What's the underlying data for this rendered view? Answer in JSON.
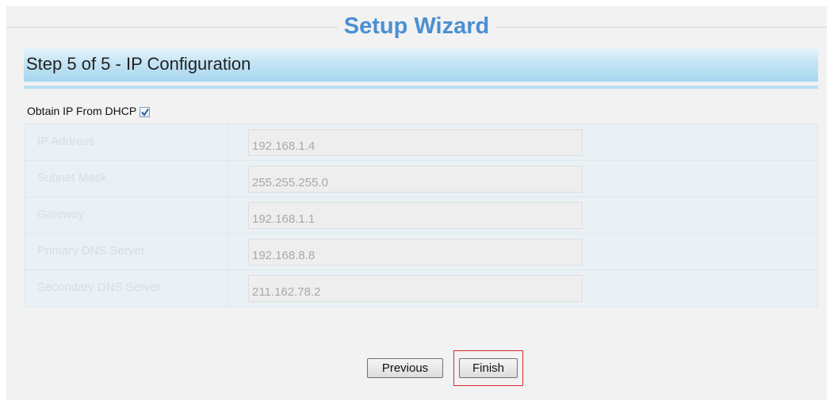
{
  "header": {
    "title": "Setup Wizard"
  },
  "step": {
    "title": "Step 5 of 5 - IP Configuration"
  },
  "dhcp": {
    "label": "Obtain IP From DHCP",
    "checked": true
  },
  "fields": [
    {
      "label": "IP Address",
      "value": "192.168.1.4"
    },
    {
      "label": "Subnet Mask",
      "value": "255.255.255.0"
    },
    {
      "label": "Gateway",
      "value": "192.168.1.1"
    },
    {
      "label": "Primary DNS Server",
      "value": "192.168.8.8"
    },
    {
      "label": "Secondary DNS Server",
      "value": "211.162.78.2"
    }
  ],
  "buttons": {
    "previous": "Previous",
    "finish": "Finish"
  },
  "colors": {
    "title": "#4a8fd3",
    "step_bar": "#a7d6ef",
    "highlight": "#d62a2a"
  }
}
